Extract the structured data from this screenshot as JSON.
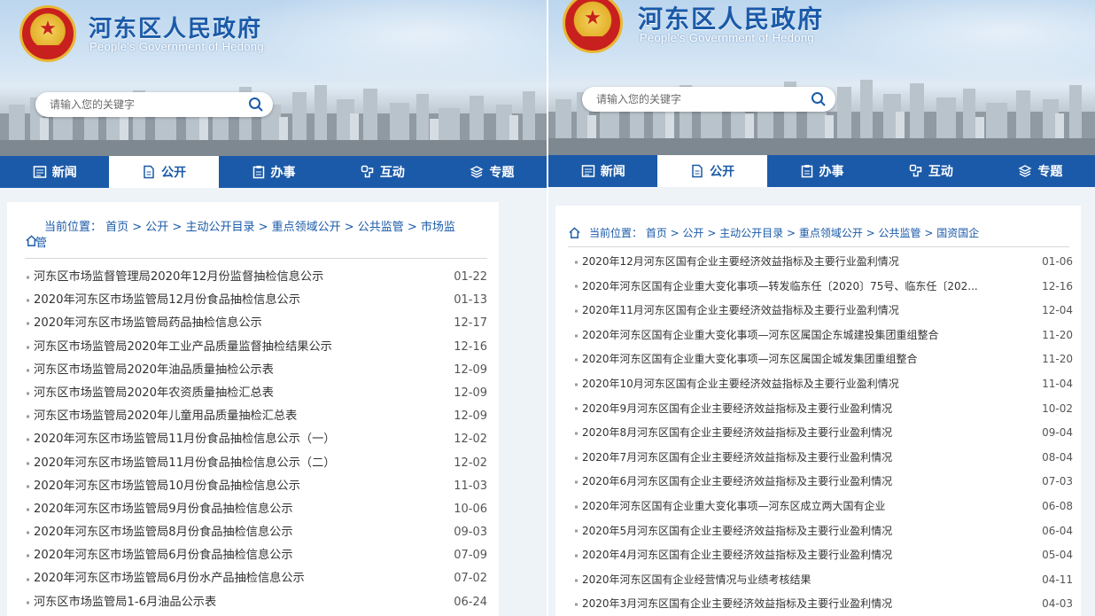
{
  "left": {
    "site": {
      "title": "河东区人民政府",
      "subtitle": "People's Government of Hedong"
    },
    "search": {
      "placeholder": "请输入您的关键字"
    },
    "nav": [
      {
        "label": "新闻",
        "icon": "news-icon"
      },
      {
        "label": "公开",
        "icon": "document-icon",
        "active": true
      },
      {
        "label": "办事",
        "icon": "clipboard-icon"
      },
      {
        "label": "互动",
        "icon": "interact-icon"
      },
      {
        "label": "专题",
        "icon": "layers-icon"
      }
    ],
    "breadcrumb": {
      "text": "当前位置： 首页 > 公开 > 主动公开目录 > 重点领域公开 > 公共监管 > 市场监",
      "tail": "管"
    },
    "items": [
      {
        "title": "河东区市场监督管理局2020年12月份监督抽检信息公示",
        "date": "01-22"
      },
      {
        "title": "2020年河东区市场监管局12月份食品抽检信息公示",
        "date": "01-13"
      },
      {
        "title": "2020年河东区市场监管局药品抽检信息公示",
        "date": "12-17"
      },
      {
        "title": "河东区市场监管局2020年工业产品质量监督抽检结果公示",
        "date": "12-16"
      },
      {
        "title": "河东区市场监管局2020年油品质量抽检公示表",
        "date": "12-09"
      },
      {
        "title": "河东区市场监管局2020年农资质量抽检汇总表",
        "date": "12-09"
      },
      {
        "title": "河东区市场监管局2020年儿童用品质量抽检汇总表",
        "date": "12-09"
      },
      {
        "title": "2020年河东区市场监管局11月份食品抽检信息公示（一）",
        "date": "12-02"
      },
      {
        "title": "2020年河东区市场监管局11月份食品抽检信息公示（二）",
        "date": "12-02"
      },
      {
        "title": "2020年河东区市场监管局10月份食品抽检信息公示",
        "date": "11-03"
      },
      {
        "title": "2020年河东区市场监管局9月份食品抽检信息公示",
        "date": "10-06"
      },
      {
        "title": "2020年河东区市场监管局8月份食品抽检信息公示",
        "date": "09-03"
      },
      {
        "title": "2020年河东区市场监管局6月份食品抽检信息公示",
        "date": "07-09"
      },
      {
        "title": "2020年河东区市场监管局6月份水产品抽检信息公示",
        "date": "07-02"
      },
      {
        "title": "河东区市场监管局1-6月油品公示表",
        "date": "06-24"
      }
    ]
  },
  "right": {
    "site": {
      "title": "河东区人民政府",
      "subtitle": "People's Government of Hedong"
    },
    "search": {
      "placeholder": "请输入您的关键字"
    },
    "nav": [
      {
        "label": "新闻",
        "icon": "news-icon"
      },
      {
        "label": "公开",
        "icon": "document-icon",
        "active": true
      },
      {
        "label": "办事",
        "icon": "clipboard-icon"
      },
      {
        "label": "互动",
        "icon": "interact-icon"
      },
      {
        "label": "专题",
        "icon": "layers-icon"
      }
    ],
    "breadcrumb": {
      "text": "当前位置： 首页 > 公开 > 主动公开目录 > 重点领域公开 > 公共监管 > 国资国企"
    },
    "items": [
      {
        "title": "2020年12月河东区国有企业主要经济效益指标及主要行业盈利情况",
        "date": "01-06"
      },
      {
        "title": "2020年河东区国有企业重大变化事项—转发临东任〔2020〕75号、临东任〔202...",
        "date": "12-16"
      },
      {
        "title": "2020年11月河东区国有企业主要经济效益指标及主要行业盈利情况",
        "date": "12-04"
      },
      {
        "title": "2020年河东区国有企业重大变化事项—河东区属国企东城建投集团重组整合",
        "date": "11-20"
      },
      {
        "title": "2020年河东区国有企业重大变化事项—河东区属国企城发集团重组整合",
        "date": "11-20"
      },
      {
        "title": "2020年10月河东区国有企业主要经济效益指标及主要行业盈利情况",
        "date": "11-04"
      },
      {
        "title": "2020年9月河东区国有企业主要经济效益指标及主要行业盈利情况",
        "date": "10-02"
      },
      {
        "title": "2020年8月河东区国有企业主要经济效益指标及主要行业盈利情况",
        "date": "09-04"
      },
      {
        "title": "2020年7月河东区国有企业主要经济效益指标及主要行业盈利情况",
        "date": "08-04"
      },
      {
        "title": "2020年6月河东区国有企业主要经济效益指标及主要行业盈利情况",
        "date": "07-03"
      },
      {
        "title": "2020年河东区国有企业重大变化事项—河东区成立两大国有企业",
        "date": "06-08"
      },
      {
        "title": "2020年5月河东区国有企业主要经济效益指标及主要行业盈利情况",
        "date": "06-04"
      },
      {
        "title": "2020年4月河东区国有企业主要经济效益指标及主要行业盈利情况",
        "date": "05-04"
      },
      {
        "title": "2020年河东区国有企业经营情况与业绩考核结果",
        "date": "04-11"
      },
      {
        "title": "2020年3月河东区国有企业主要经济效益指标及主要行业盈利情况",
        "date": "04-03"
      }
    ]
  },
  "colors": {
    "brand_blue": "#1b5aa8",
    "emblem_red": "#c8201e",
    "emblem_gold": "#e8b733",
    "text": "#333333",
    "background": "#eef3f8"
  }
}
